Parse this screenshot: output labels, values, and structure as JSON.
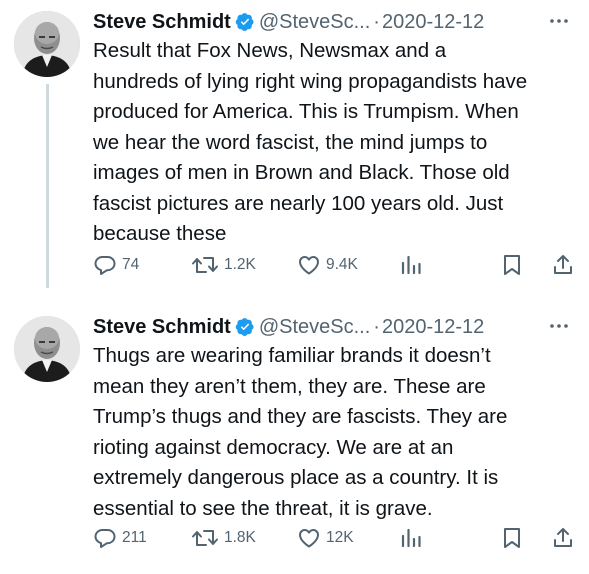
{
  "tweets": [
    {
      "author": "Steve Schmidt",
      "handle": "@SteveSc...",
      "separator": "·",
      "date": "2020-12-12",
      "text": "Result that Fox News, Newsmax and a\nhundreds of lying right wing propagandists have\nproduced for America. This is Trumpism. When\nwe hear the word fascist, the mind jumps to\nimages of men in Brown and Black.  Those old\nfascist pictures are nearly 100 years old. Just\nbecause these",
      "replies": "74",
      "retweets": "1.2K",
      "likes": "9.4K"
    },
    {
      "author": "Steve Schmidt",
      "handle": "@SteveSc...",
      "separator": "·",
      "date": "2020-12-12",
      "text": "Thugs are wearing familiar brands it doesn’t\nmean they aren’t them, they are. These are\nTrump’s thugs and they are fascists. They are\nrioting against democracy. We are at an\nextremely dangerous place as a country. It is\nessential to see the threat, it is grave.",
      "replies": "211",
      "retweets": "1.8K",
      "likes": "12K"
    }
  ],
  "icons": {
    "verified": "verified-badge-icon",
    "more": "more-icon",
    "reply": "reply-icon",
    "retweet": "retweet-icon",
    "like": "like-icon",
    "views": "views-icon",
    "bookmark": "bookmark-icon",
    "share": "share-icon"
  },
  "colors": {
    "verified": "#1d9bf0",
    "secondary_text": "#536471",
    "thread_line": "#cfd9de"
  }
}
